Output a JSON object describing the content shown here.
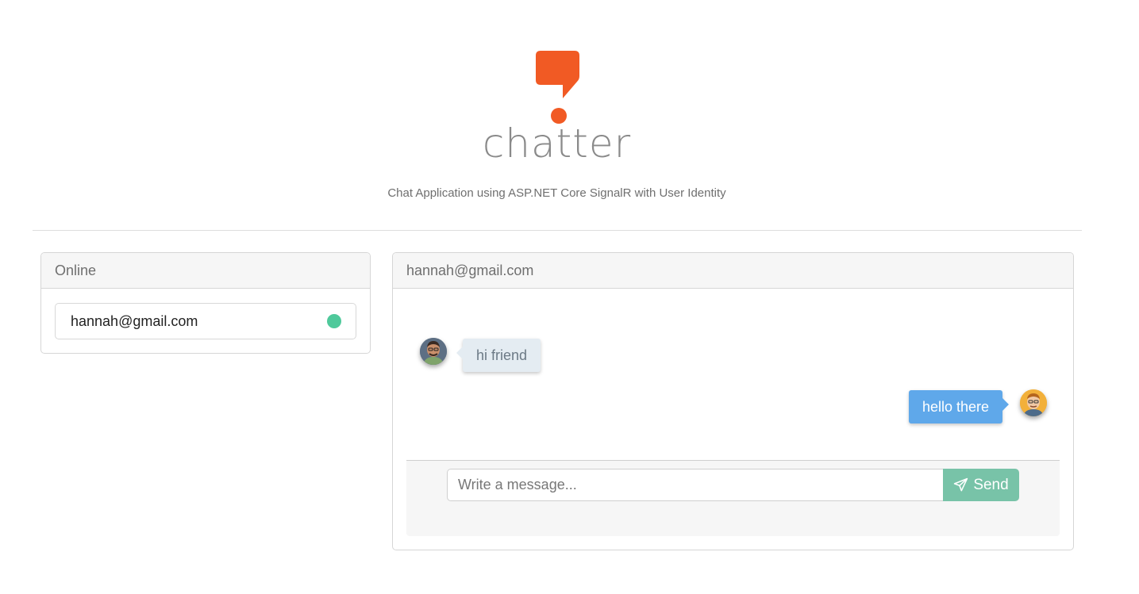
{
  "brand": {
    "name": "chatter",
    "tagline": "Chat Application using ASP.NET Core SignalR with User Identity",
    "icon": "speech-bubble-exclamation-icon",
    "color": "#f15a24"
  },
  "online_panel": {
    "title": "Online",
    "users": [
      {
        "email": "hannah@gmail.com",
        "status_color": "#4fc99b"
      }
    ]
  },
  "chat_panel": {
    "title": "hannah@gmail.com",
    "messages": [
      {
        "direction": "incoming",
        "text": "hi friend",
        "avatar": "avatar-icon"
      },
      {
        "direction": "outgoing",
        "text": "hello there",
        "avatar": "avatar-icon"
      }
    ],
    "compose": {
      "placeholder": "Write a message...",
      "send_label": "Send",
      "send_icon": "paper-plane-icon"
    }
  },
  "colors": {
    "incoming_bubble": "#e4ecf2",
    "outgoing_bubble": "#5fa8ea",
    "send_button": "#78c3a8"
  }
}
